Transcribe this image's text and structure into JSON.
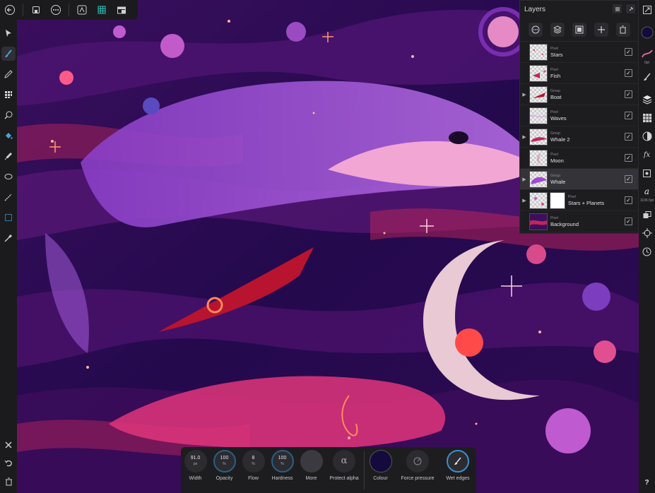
{
  "top_toolbar": {
    "icons": [
      "back-icon",
      "document-icon",
      "more-icon",
      "pixel-persona-icon",
      "grid-persona-icon",
      "export-persona-icon"
    ]
  },
  "tools": {
    "items": [
      "move-tool-icon",
      "paint-brush-icon",
      "pencil-icon",
      "pixel-tool-icon",
      "smudge-icon",
      "fill-icon",
      "color-picker-icon",
      "selection-ellipse-icon",
      "selection-brush-icon",
      "marquee-icon",
      "eyedropper-icon"
    ],
    "bottom": [
      "close-icon",
      "undo-icon",
      "trash-icon"
    ]
  },
  "layers_panel": {
    "title": "Layers",
    "layers": [
      {
        "type": "Pixel",
        "name": "Stars",
        "group": false,
        "visible": true,
        "selected": false,
        "thumb": "stars"
      },
      {
        "type": "Pixel",
        "name": "Fish",
        "group": false,
        "visible": true,
        "selected": false,
        "thumb": "fish"
      },
      {
        "type": "Group",
        "name": "Boat",
        "group": true,
        "visible": true,
        "selected": false,
        "thumb": "boat"
      },
      {
        "type": "Pixel",
        "name": "Waves",
        "group": false,
        "visible": true,
        "selected": false,
        "thumb": "waves"
      },
      {
        "type": "Group",
        "name": "Whale 2",
        "group": true,
        "visible": true,
        "selected": false,
        "thumb": "whale2"
      },
      {
        "type": "Pixel",
        "name": "Moon",
        "group": false,
        "visible": true,
        "selected": false,
        "thumb": "moon"
      },
      {
        "type": "Group",
        "name": "Whale",
        "group": true,
        "visible": true,
        "selected": true,
        "thumb": "whale"
      },
      {
        "type": "Pixel",
        "name": "Stars + Planets",
        "group": true,
        "visible": true,
        "selected": false,
        "thumb": "planets",
        "mask": true
      },
      {
        "type": "Pixel",
        "name": "Background",
        "group": false,
        "visible": true,
        "selected": false,
        "thumb": "background"
      }
    ]
  },
  "right_bar": {
    "brush_size_label": "0pt",
    "font_size_label": "1106.5pt",
    "help_label": "?"
  },
  "context_toolbar": {
    "width": {
      "value": "91.0",
      "unit": "px",
      "label": "Width"
    },
    "opacity": {
      "value": "100",
      "unit": "%",
      "label": "Opacity"
    },
    "flow": {
      "value": "8",
      "unit": "%",
      "label": "Flow"
    },
    "hardness": {
      "value": "100",
      "unit": "%",
      "label": "Hardness"
    },
    "more": {
      "label": "More"
    },
    "protect_alpha": {
      "symbol": "α",
      "label": "Protect alpha"
    },
    "colour": {
      "label": "Colour",
      "value": "#140a3c"
    },
    "force_pressure": {
      "label": "Force pressure"
    },
    "wet_edges": {
      "label": "Wet edges"
    }
  },
  "colors": {
    "accent": "#3b8ed0",
    "primary_colour": "#140a3c",
    "panel_bg": "#1d1d20"
  }
}
